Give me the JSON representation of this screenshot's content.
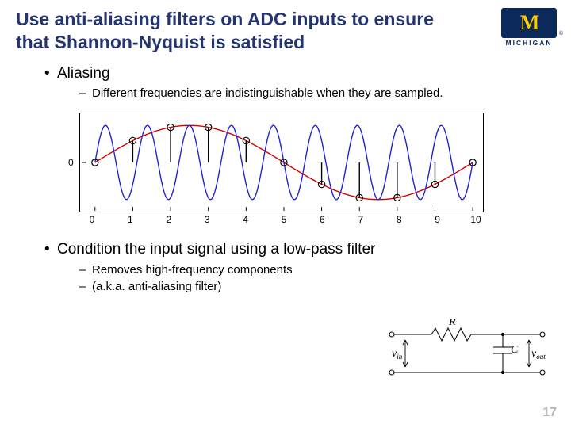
{
  "title": "Use anti-aliasing filters on ADC inputs to ensure that Shannon-Nyquist is satisfied",
  "logo": {
    "letter": "M",
    "sub": "MICHIGAN",
    "copy": "©"
  },
  "bullets": {
    "b1a": "Aliasing",
    "b1a_sub1": "Different frequencies are indistinguishable when they are sampled.",
    "b1b": "Condition the input signal using a low-pass filter",
    "b1b_sub1": "Removes high-frequency components",
    "b1b_sub2": "(a.k.a. anti-aliasing filter)"
  },
  "chart_data": {
    "type": "line",
    "x": [
      0,
      1,
      2,
      3,
      4,
      5,
      6,
      7,
      8,
      9,
      10
    ],
    "xlabel": "",
    "ylabel": "",
    "xlim": [
      0,
      10
    ],
    "ylim": [
      -1.2,
      1.2
    ],
    "yticks": [
      0
    ],
    "series": [
      {
        "name": "red-sine-low-freq",
        "color": "#d00000",
        "freq": 0.1,
        "amp": 1.0
      },
      {
        "name": "blue-sine-high-freq",
        "color": "#2020d0",
        "freq": 0.9,
        "amp": 1.0
      }
    ],
    "samples_x": [
      0,
      1,
      2,
      3,
      4,
      5,
      6,
      7,
      8,
      9,
      10
    ],
    "samples_y": [
      0.0,
      0.59,
      0.95,
      0.95,
      0.59,
      0.0,
      -0.59,
      -0.95,
      -0.95,
      -0.59,
      0.0
    ]
  },
  "circuit": {
    "R": "R",
    "C": "C",
    "vin": "v",
    "vin_sub": "in",
    "vout": "v",
    "vout_sub": "out"
  },
  "page": "17",
  "glyphs": {
    "bullet": "•",
    "dash": "–"
  }
}
